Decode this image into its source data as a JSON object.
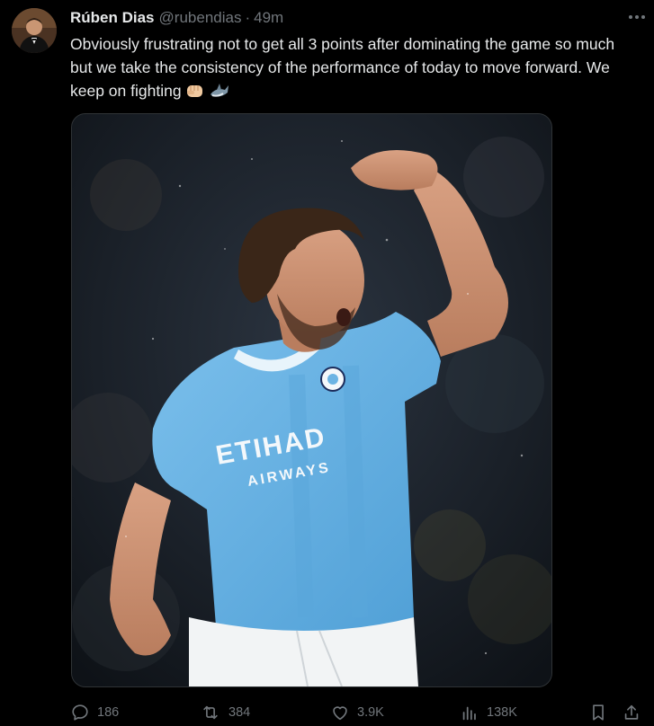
{
  "tweet": {
    "author": {
      "display_name": "Rúben Dias",
      "handle": "@rubendias",
      "time": "49m"
    },
    "separator": "·",
    "text": "Obviously frustrating not to get all 3 points after dominating the game so much but we take the consistency of the performance of today to move forward. We keep on fighting",
    "emojis": [
      "oncoming-fist-emoji",
      "shark-emoji"
    ],
    "media": {
      "description_icon": "photo",
      "shirt_sponsor": {
        "line1": "ETIHAD",
        "line2": "AIRWAYS"
      }
    },
    "actions": {
      "replies": "186",
      "reposts": "384",
      "likes": "3.9K",
      "views": "138K"
    }
  },
  "colors": {
    "background": "#000000",
    "text_primary": "#e7e9ea",
    "text_secondary": "#71767b",
    "border": "#2f3336",
    "jersey": "#6cb4e4"
  }
}
